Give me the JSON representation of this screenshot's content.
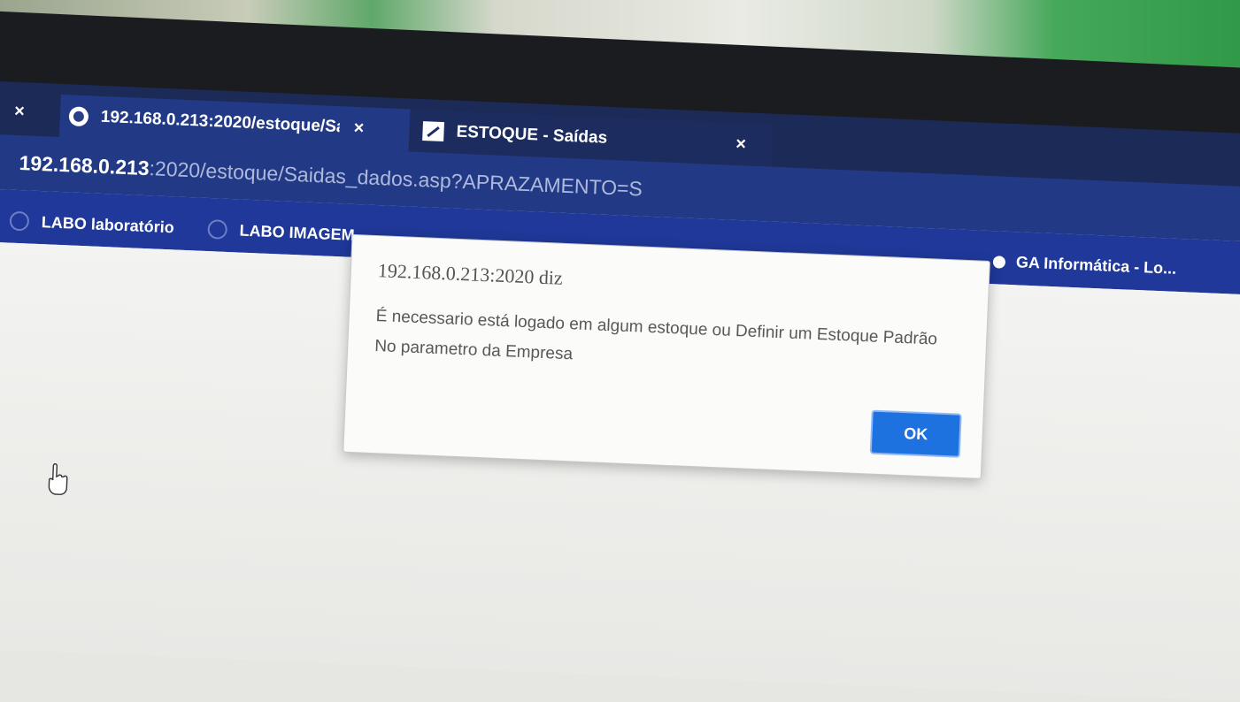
{
  "browser": {
    "close_all_label": "×",
    "tabs": [
      {
        "title": "192.168.0.213:2020/estoque/Sai",
        "close": "×"
      },
      {
        "title": "ESTOQUE - Saídas",
        "close": "×"
      }
    ],
    "new_tab_label": "+",
    "url": {
      "host": "192.168.0.213",
      "rest": ":2020/estoque/Saidas_dados.asp?APRAZAMENTO=S"
    }
  },
  "bookmarks": [
    {
      "label": "LABO laboratório",
      "icon": "globe-icon"
    },
    {
      "label": "LABO IMAGEM",
      "icon": "globe-icon"
    },
    {
      "label": "GA Informática - Lo...",
      "icon": "site-icon"
    }
  ],
  "dialog": {
    "title": "192.168.0.213:2020 diz",
    "message": "É necessario está logado em algum estoque ou Definir um Estoque Padrão No parametro da Empresa",
    "ok_label": "OK"
  },
  "colors": {
    "tabstrip": "#1c2a57",
    "addressbar": "#223a86",
    "bookmarks": "#1f3899",
    "ok_button": "#1d72e0"
  }
}
